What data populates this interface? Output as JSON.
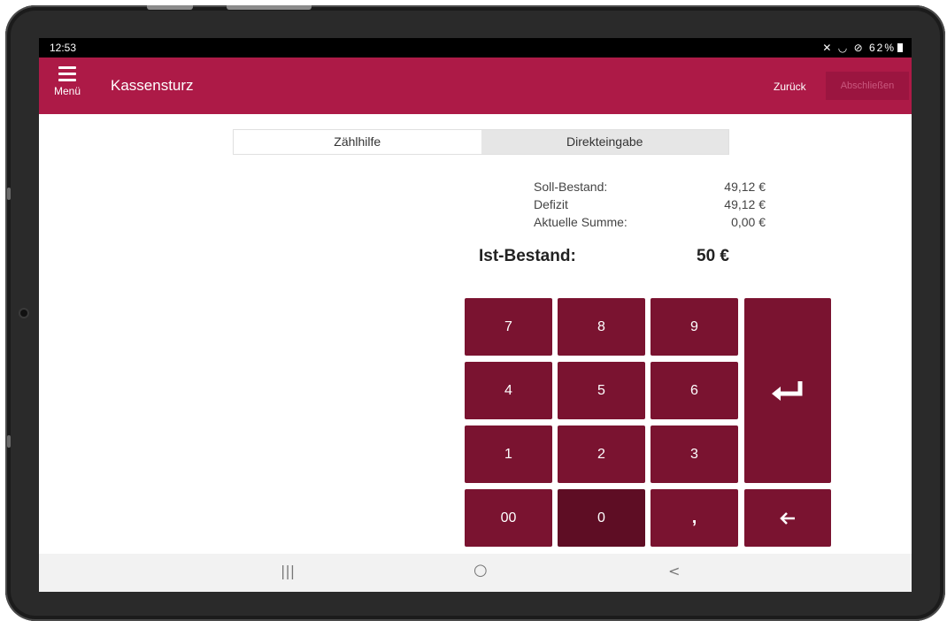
{
  "status": {
    "time": "12:53",
    "indicators": "✕ ◡ ⊘",
    "battery": "62%"
  },
  "appbar": {
    "menu_label": "Menü",
    "title": "Kassensturz",
    "back_label": "Zurück",
    "finish_label": "Abschließen"
  },
  "tabs": [
    {
      "label": "Zählhilfe",
      "active": true
    },
    {
      "label": "Direkteingabe",
      "active": false
    }
  ],
  "summary": {
    "soll_label": "Soll-Bestand:",
    "soll_value": "49,12 €",
    "defizit_label": "Defizit",
    "defizit_value": "49,12 €",
    "summe_label": "Aktuelle Summe:",
    "summe_value": "0,00 €",
    "ist_label": "Ist-Bestand:",
    "ist_value": "50 €"
  },
  "keypad": {
    "k7": "7",
    "k8": "8",
    "k9": "9",
    "k4": "4",
    "k5": "5",
    "k6": "6",
    "k1": "1",
    "k2": "2",
    "k3": "3",
    "k00": "00",
    "k0": "0",
    "comma": ",",
    "enter_icon": "↵",
    "backspace_icon": "←"
  },
  "navbar": {
    "recents_icon": "|||",
    "home_icon": "○",
    "back_icon": "<"
  },
  "colors": {
    "brand": "#ad1a47",
    "key": "#7a1330"
  }
}
